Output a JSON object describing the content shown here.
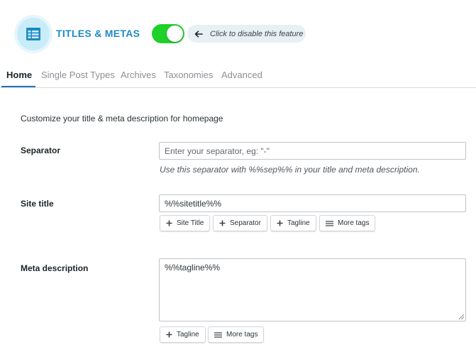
{
  "header": {
    "title": "TITLES & METAS",
    "feature_hint": "Click to disable this feature"
  },
  "tabs": [
    {
      "label": "Home"
    },
    {
      "label": "Single Post Types"
    },
    {
      "label": "Archives"
    },
    {
      "label": "Taxonomies"
    },
    {
      "label": "Advanced"
    }
  ],
  "home": {
    "intro": "Customize your title & meta description for homepage",
    "separator": {
      "label": "Separator",
      "placeholder": "Enter your separator, eg: \"-\"",
      "help": "Use this separator with %%sep%% in your title and meta description."
    },
    "site_title": {
      "label": "Site title",
      "value": "%%sitetitle%%",
      "tags": [
        "Site Title",
        "Separator",
        "Tagline",
        "More tags"
      ]
    },
    "meta_description": {
      "label": "Meta description",
      "value": "%%tagline%%",
      "tags": [
        "Tagline",
        "More tags"
      ]
    }
  },
  "colors": {
    "accent": "#1c8ac4",
    "toggle_on": "#1fd02a",
    "tab_active_underline": "#2271b1"
  },
  "icons": {
    "logo": "list-table-icon",
    "hint": "arrow-left-icon",
    "tag_add": "plus-icon",
    "more_tags": "menu-icon"
  }
}
